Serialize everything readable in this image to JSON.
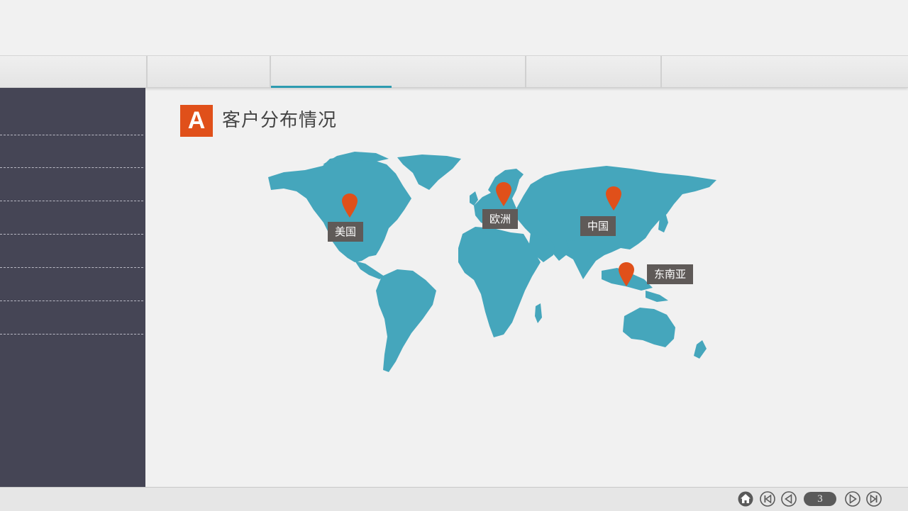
{
  "heading": {
    "badge_letter": "A",
    "title": "客户分布情况"
  },
  "map": {
    "fill_color": "#45a6bc",
    "pin_color": "#e0501a",
    "locations": [
      {
        "label": "美国"
      },
      {
        "label": "欧洲"
      },
      {
        "label": "中国"
      },
      {
        "label": "东南亚"
      }
    ]
  },
  "footer": {
    "page_number": "3"
  },
  "icons": [
    "home-icon",
    "first-page-icon",
    "prev-page-icon",
    "next-page-icon",
    "last-page-icon"
  ]
}
